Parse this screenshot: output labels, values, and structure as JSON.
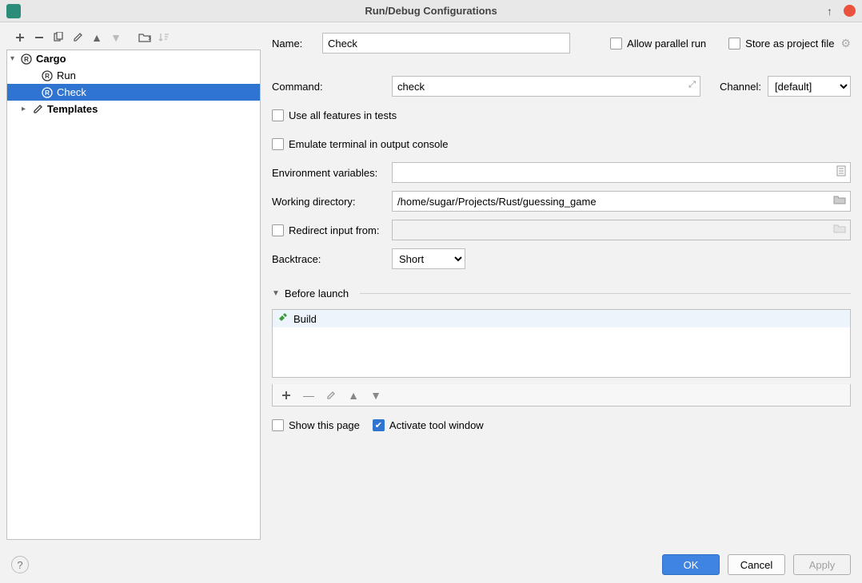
{
  "window": {
    "title": "Run/Debug Configurations"
  },
  "tree": {
    "cargo": {
      "label": "Cargo"
    },
    "run": {
      "label": "Run"
    },
    "check": {
      "label": "Check"
    },
    "templates": {
      "label": "Templates"
    }
  },
  "form": {
    "name_label": "Name:",
    "name_value": "Check",
    "allow_parallel_label": "Allow parallel run",
    "store_project_label": "Store as project file",
    "command_label": "Command:",
    "command_value": "check",
    "channel_label": "Channel:",
    "channel_value": "[default]",
    "use_all_features_label": "Use all features in tests",
    "emulate_terminal_label": "Emulate terminal in output console",
    "env_label": "Environment variables:",
    "env_value": "",
    "workdir_label": "Working directory:",
    "workdir_value": "/home/sugar/Projects/Rust/guessing_game",
    "redirect_label": "Redirect input from:",
    "redirect_value": "",
    "backtrace_label": "Backtrace:",
    "backtrace_value": "Short",
    "before_launch_label": "Before launch",
    "before_item_label": "Build",
    "show_this_page_label": "Show this page",
    "activate_tool_window_label": "Activate tool window"
  },
  "footer": {
    "ok": "OK",
    "cancel": "Cancel",
    "apply": "Apply"
  }
}
